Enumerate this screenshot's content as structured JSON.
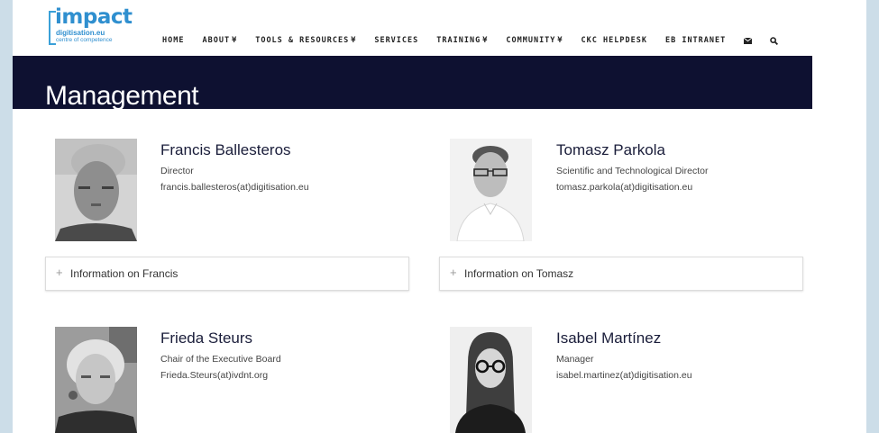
{
  "logo": {
    "main": "impact",
    "sub": "digitisation.eu",
    "tagline": "centre of competence"
  },
  "nav": {
    "items": [
      {
        "label": "HOME",
        "dropdown": false
      },
      {
        "label": "ABOUT",
        "dropdown": true
      },
      {
        "label": "TOOLS & RESOURCES",
        "dropdown": true
      },
      {
        "label": "SERVICES",
        "dropdown": false
      },
      {
        "label": "TRAINING",
        "dropdown": true
      },
      {
        "label": "COMMUNITY",
        "dropdown": true
      },
      {
        "label": "CKC HELPDESK",
        "dropdown": false
      },
      {
        "label": "EB INTRANET",
        "dropdown": false
      }
    ],
    "caret": "¥",
    "icons": [
      "envelope-icon",
      "search-icon"
    ]
  },
  "page": {
    "title": "Management"
  },
  "people": [
    {
      "name": "Francis Ballesteros",
      "role": "Director",
      "email": "francis.ballesteros(at)digitisation.eu",
      "accordion": "Information on Francis"
    },
    {
      "name": "Tomasz Parkola",
      "role": "Scientific and Technological Director",
      "email": "tomasz.parkola(at)digitisation.eu",
      "accordion": "Information on Tomasz"
    },
    {
      "name": "Frieda Steurs",
      "role": "Chair of the Executive Board",
      "email": "Frieda.Steurs(at)ivdnt.org"
    },
    {
      "name": "Isabel Martínez",
      "role": "Manager",
      "email": "isabel.martinez(at)digitisation.eu"
    }
  ],
  "colors": {
    "brand": "#2f8fcf",
    "titleband": "#0e1131",
    "outer": "#ccdde8"
  }
}
